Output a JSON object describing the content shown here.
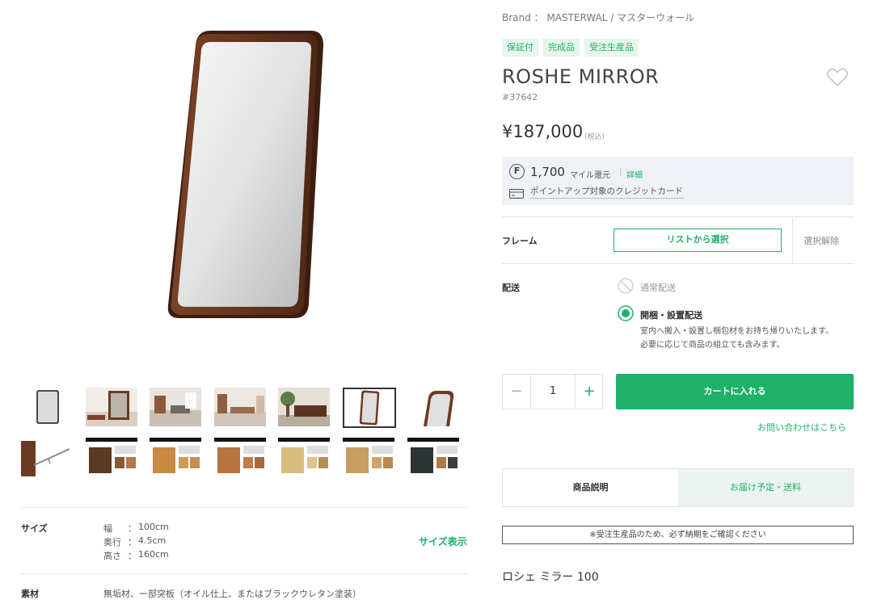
{
  "product": {
    "brand_line": "Brand ： MASTERWAL / マスターウォール",
    "tags": [
      "保証付",
      "完成品",
      "受注生産品"
    ],
    "title": "ROSHE MIRROR",
    "sku": "#37642",
    "price": "¥187,000",
    "tax_note": "(税込)"
  },
  "points": {
    "badge": "F",
    "amount": "1,700",
    "unit": "マイル還元",
    "separator": "|",
    "detail_link": "詳細",
    "card_text": "ポイントアップ対象のクレジットカード"
  },
  "options": {
    "frame_label": "フレーム",
    "frame_select": "リストから選択",
    "frame_clear": "選択解除",
    "delivery_label": "配送",
    "delivery_options": [
      {
        "label": "通常配送",
        "state": "disabled"
      },
      {
        "label": "開梱・設置配送",
        "state": "selected"
      }
    ],
    "delivery_desc_1": "室内へ搬入・設置し梱包材をお持ち帰りいたします。",
    "delivery_desc_2": "必要に応じて商品の組立ても含みます。"
  },
  "cart": {
    "minus": "−",
    "quantity": "1",
    "plus": "+",
    "add_to_cart": "カートに入れる",
    "inquiry": "お問い合わせはこちら"
  },
  "tabs": {
    "description": "商品説明",
    "delivery": "お届け予定・送料"
  },
  "notice": "※受注生産品のため、必ず納期をご確認ください",
  "description_title": "ロシェ ミラー 100",
  "specs": {
    "size_label": "サイズ",
    "width_key": "幅",
    "width_val": "100cm",
    "depth_key": "奥行",
    "depth_val": "4.5cm",
    "height_key": "高さ",
    "height_val": "160cm",
    "colon": "：",
    "size_link": "サイズ表示",
    "material_label": "素材",
    "material_val": "無垢材、一部突板（オイル仕上、またはブラックウレタン塗装）"
  },
  "gallery": {
    "thumbnail_count": 14,
    "selected_index": 5
  },
  "colors": {
    "accent": "#1db16a",
    "tag_bg": "#e6f6ec",
    "points_bg": "#eef1f5",
    "frame_wood": "#6b3a22"
  }
}
